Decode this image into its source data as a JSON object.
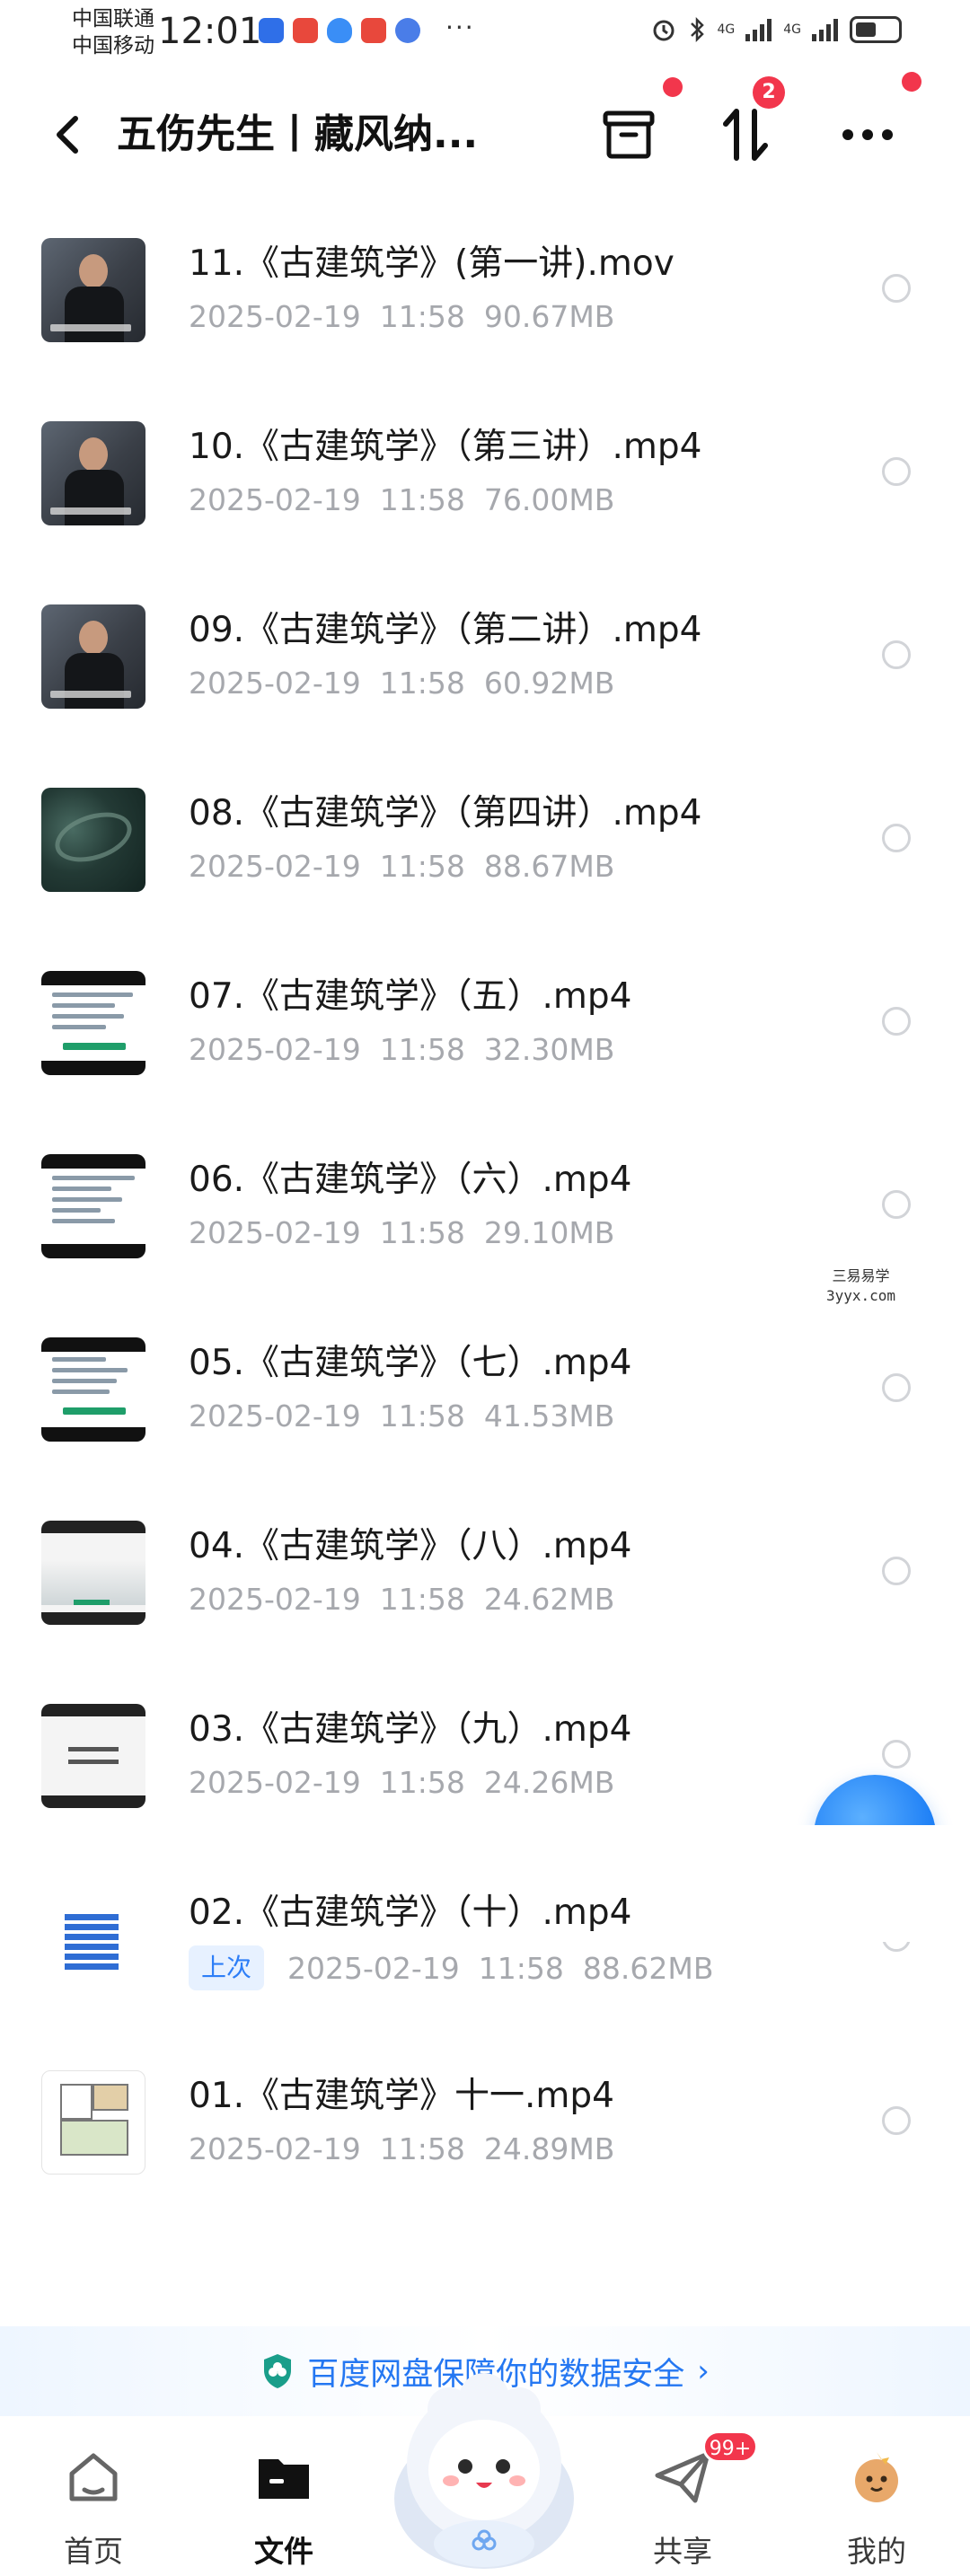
{
  "status_bar": {
    "carrier_1": "中国联通",
    "carrier_2": "中国移动",
    "time": "12:01",
    "signal_1": "4G",
    "signal_2": "4G"
  },
  "header": {
    "title": "五伤先生丨藏风纳...",
    "transfer_badge": "2"
  },
  "files": [
    {
      "name": "11.《古建筑学》(第一讲).mov",
      "date": "2025-02-19",
      "time": "11:58",
      "size": "90.67MB",
      "last_viewed": ""
    },
    {
      "name": "10.《古建筑学》（第三讲）.mp4",
      "date": "2025-02-19",
      "time": "11:58",
      "size": "76.00MB",
      "last_viewed": ""
    },
    {
      "name": "09.《古建筑学》（第二讲）.mp4",
      "date": "2025-02-19",
      "time": "11:58",
      "size": "60.92MB",
      "last_viewed": ""
    },
    {
      "name": "08.《古建筑学》（第四讲）.mp4",
      "date": "2025-02-19",
      "time": "11:58",
      "size": "88.67MB",
      "last_viewed": ""
    },
    {
      "name": "07.《古建筑学》（五）.mp4",
      "date": "2025-02-19",
      "time": "11:58",
      "size": "32.30MB",
      "last_viewed": ""
    },
    {
      "name": "06.《古建筑学》（六）.mp4",
      "date": "2025-02-19",
      "time": "11:58",
      "size": "29.10MB",
      "last_viewed": ""
    },
    {
      "name": "05.《古建筑学》（七）.mp4",
      "date": "2025-02-19",
      "time": "11:58",
      "size": "41.53MB",
      "last_viewed": ""
    },
    {
      "name": "04.《古建筑学》（八）.mp4",
      "date": "2025-02-19",
      "time": "11:58",
      "size": "24.62MB",
      "last_viewed": ""
    },
    {
      "name": "03.《古建筑学》（九）.mp4",
      "date": "2025-02-19",
      "time": "11:58",
      "size": "24.26MB",
      "last_viewed": ""
    },
    {
      "name": "02.《古建筑学》（十）.mp4",
      "date": "2025-02-19",
      "time": "11:58",
      "size": "88.62MB",
      "last_viewed": "上次"
    },
    {
      "name": "01.《古建筑学》十一.mp4",
      "date": "2025-02-19",
      "time": "11:58",
      "size": "24.89MB",
      "last_viewed": ""
    }
  ],
  "watermark": {
    "line_1": "三易易学",
    "line_2": "3yyx.com"
  },
  "security_banner": {
    "text": "百度网盘保障你的数据安全",
    "chevron": "›"
  },
  "tab_bar": {
    "home": "首页",
    "files": "文件",
    "share": "共享",
    "share_badge": "99+",
    "mine": "我的"
  },
  "colors": {
    "accent": "#2477f2",
    "badge": "#f2364c",
    "meta_text": "#a6a8ad"
  }
}
